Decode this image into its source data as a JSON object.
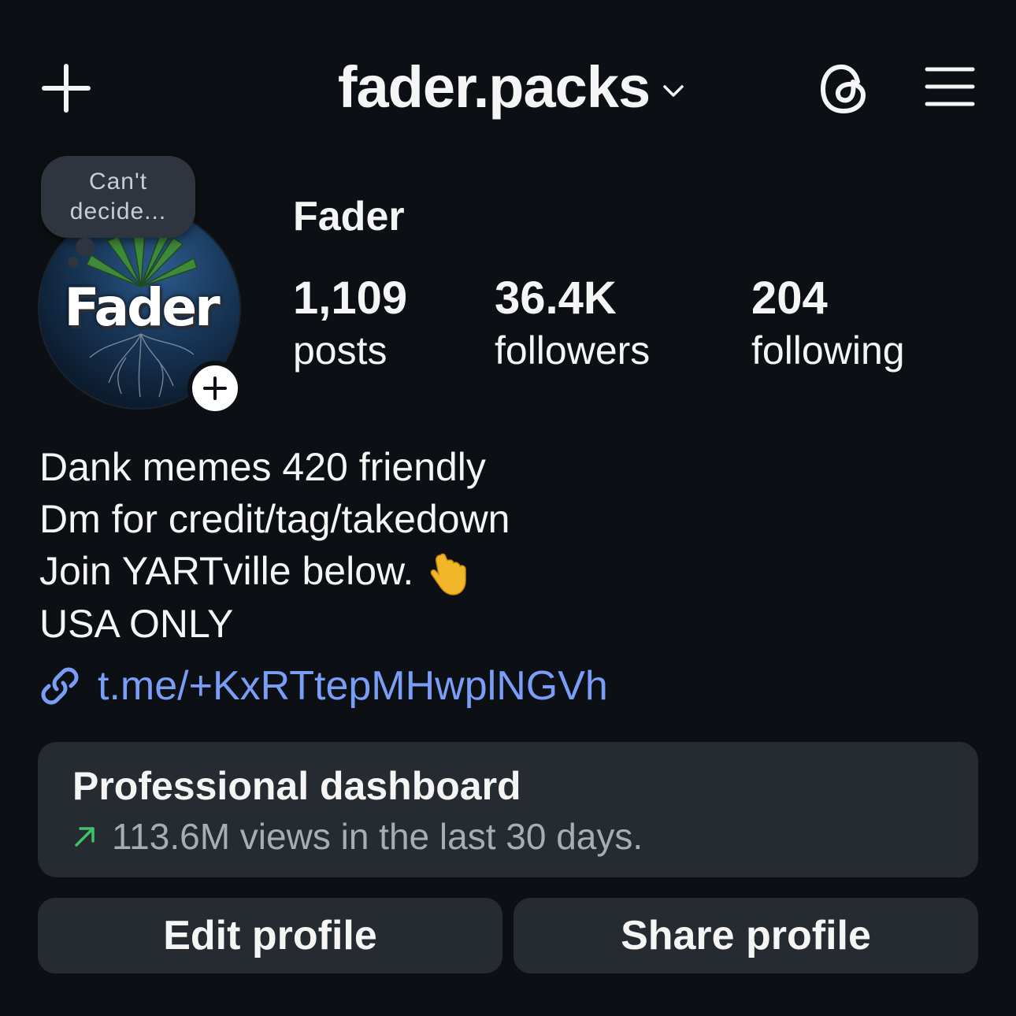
{
  "header": {
    "username": "fader.packs"
  },
  "profile": {
    "display_name": "Fader",
    "avatar_text": "Fader",
    "note": "Can't decide..."
  },
  "stats": {
    "posts": {
      "value": "1,109",
      "label": "posts"
    },
    "followers": {
      "value": "36.4K",
      "label": "followers"
    },
    "following": {
      "value": "204",
      "label": "following"
    }
  },
  "bio": {
    "lines": [
      "Dank memes 420 friendly",
      "Dm for credit/tag/takedown",
      "Join YARTville below.",
      "USA ONLY"
    ],
    "emoji": "pointing-down-hand",
    "link": "t.me/+KxRTtepMHwplNGVh"
  },
  "dashboard": {
    "title": "Professional dashboard",
    "subtitle": "113.6M views in the last 30 days.",
    "trend_color": "#3ec36a"
  },
  "buttons": {
    "edit": "Edit profile",
    "share": "Share profile"
  },
  "colors": {
    "background": "#0c1014",
    "link": "#7a9ef7",
    "card": "#262a31"
  }
}
